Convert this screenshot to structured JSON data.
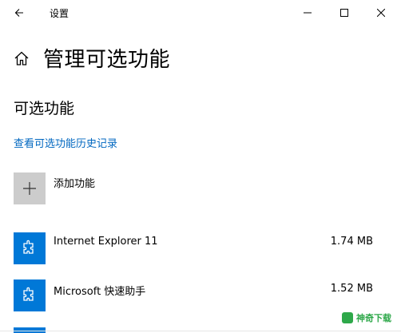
{
  "window": {
    "title": "设置",
    "back_icon": "back-arrow-icon",
    "controls": [
      "minimize-icon",
      "maximize-icon",
      "close-icon"
    ]
  },
  "header": {
    "home_icon": "home-icon",
    "title": "管理可选功能"
  },
  "section": {
    "title": "可选功能",
    "history_link": "查看可选功能历史记录"
  },
  "add_feature": {
    "icon": "plus-icon",
    "label": "添加功能"
  },
  "features": [
    {
      "icon": "puzzle-icon",
      "name": "Internet Explorer 11",
      "size": "1.74 MB"
    },
    {
      "icon": "puzzle-icon",
      "name": "Microsoft 快速助手",
      "size": "1.52 MB"
    }
  ],
  "watermark": {
    "text": "神奇下载"
  },
  "colors": {
    "accent": "#0078d7",
    "link": "#0067c0",
    "add_tile": "#cccccc"
  }
}
